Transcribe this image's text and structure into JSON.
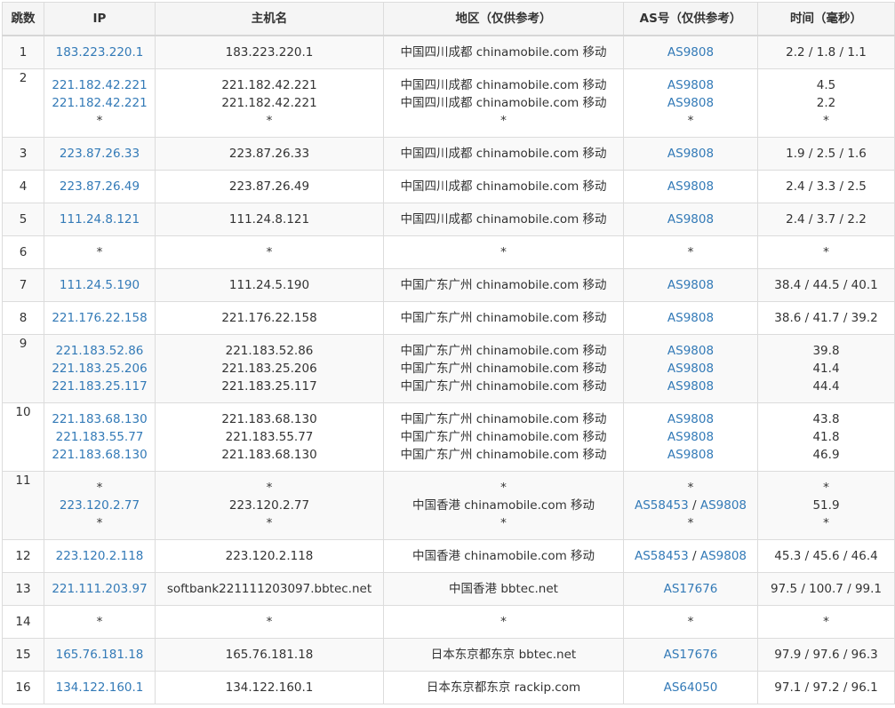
{
  "columns": [
    "跳数",
    "IP",
    "主机名",
    "地区（仅供参考）",
    "AS号（仅供参考）",
    "时间（毫秒）"
  ],
  "rows": [
    {
      "hop": "1",
      "ips": [
        "183.223.220.1"
      ],
      "hosts": [
        "183.223.220.1"
      ],
      "regions": [
        "中国四川成都 chinamobile.com 移动"
      ],
      "asns": [
        [
          "AS9808"
        ]
      ],
      "times": [
        "2.2 / 1.8 / 1.1"
      ]
    },
    {
      "hop": "2",
      "ips": [
        "221.182.42.221",
        "221.182.42.221",
        "*"
      ],
      "hosts": [
        "221.182.42.221",
        "221.182.42.221",
        "*"
      ],
      "regions": [
        "中国四川成都 chinamobile.com 移动",
        "中国四川成都 chinamobile.com 移动",
        "*"
      ],
      "asns": [
        [
          "AS9808"
        ],
        [
          "AS9808"
        ],
        [
          "*"
        ]
      ],
      "times": [
        "4.5",
        "2.2",
        "*"
      ]
    },
    {
      "hop": "3",
      "ips": [
        "223.87.26.33"
      ],
      "hosts": [
        "223.87.26.33"
      ],
      "regions": [
        "中国四川成都 chinamobile.com 移动"
      ],
      "asns": [
        [
          "AS9808"
        ]
      ],
      "times": [
        "1.9 / 2.5 / 1.6"
      ]
    },
    {
      "hop": "4",
      "ips": [
        "223.87.26.49"
      ],
      "hosts": [
        "223.87.26.49"
      ],
      "regions": [
        "中国四川成都 chinamobile.com 移动"
      ],
      "asns": [
        [
          "AS9808"
        ]
      ],
      "times": [
        "2.4 / 3.3 / 2.5"
      ]
    },
    {
      "hop": "5",
      "ips": [
        "111.24.8.121"
      ],
      "hosts": [
        "111.24.8.121"
      ],
      "regions": [
        "中国四川成都 chinamobile.com 移动"
      ],
      "asns": [
        [
          "AS9808"
        ]
      ],
      "times": [
        "2.4 / 3.7 / 2.2"
      ]
    },
    {
      "hop": "6",
      "ips": [
        "*"
      ],
      "hosts": [
        "*"
      ],
      "regions": [
        "*"
      ],
      "asns": [
        [
          "*"
        ]
      ],
      "times": [
        "*"
      ]
    },
    {
      "hop": "7",
      "ips": [
        "111.24.5.190"
      ],
      "hosts": [
        "111.24.5.190"
      ],
      "regions": [
        "中国广东广州 chinamobile.com 移动"
      ],
      "asns": [
        [
          "AS9808"
        ]
      ],
      "times": [
        "38.4 / 44.5 / 40.1"
      ]
    },
    {
      "hop": "8",
      "ips": [
        "221.176.22.158"
      ],
      "hosts": [
        "221.176.22.158"
      ],
      "regions": [
        "中国广东广州 chinamobile.com 移动"
      ],
      "asns": [
        [
          "AS9808"
        ]
      ],
      "times": [
        "38.6 / 41.7 / 39.2"
      ]
    },
    {
      "hop": "9",
      "ips": [
        "221.183.52.86",
        "221.183.25.206",
        "221.183.25.117"
      ],
      "hosts": [
        "221.183.52.86",
        "221.183.25.206",
        "221.183.25.117"
      ],
      "regions": [
        "中国广东广州 chinamobile.com 移动",
        "中国广东广州 chinamobile.com 移动",
        "中国广东广州 chinamobile.com 移动"
      ],
      "asns": [
        [
          "AS9808"
        ],
        [
          "AS9808"
        ],
        [
          "AS9808"
        ]
      ],
      "times": [
        "39.8",
        "41.4",
        "44.4"
      ]
    },
    {
      "hop": "10",
      "ips": [
        "221.183.68.130",
        "221.183.55.77",
        "221.183.68.130"
      ],
      "hosts": [
        "221.183.68.130",
        "221.183.55.77",
        "221.183.68.130"
      ],
      "regions": [
        "中国广东广州 chinamobile.com 移动",
        "中国广东广州 chinamobile.com 移动",
        "中国广东广州 chinamobile.com 移动"
      ],
      "asns": [
        [
          "AS9808"
        ],
        [
          "AS9808"
        ],
        [
          "AS9808"
        ]
      ],
      "times": [
        "43.8",
        "41.8",
        "46.9"
      ]
    },
    {
      "hop": "11",
      "ips": [
        "*",
        "223.120.2.77",
        "*"
      ],
      "hosts": [
        "*",
        "223.120.2.77",
        "*"
      ],
      "regions": [
        "*",
        "中国香港 chinamobile.com 移动",
        "*"
      ],
      "asns": [
        [
          "*"
        ],
        [
          "AS58453",
          "AS9808"
        ],
        [
          "*"
        ]
      ],
      "times": [
        "*",
        "51.9",
        "*"
      ]
    },
    {
      "hop": "12",
      "ips": [
        "223.120.2.118"
      ],
      "hosts": [
        "223.120.2.118"
      ],
      "regions": [
        "中国香港 chinamobile.com 移动"
      ],
      "asns": [
        [
          "AS58453",
          "AS9808"
        ]
      ],
      "times": [
        "45.3 / 45.6 / 46.4"
      ]
    },
    {
      "hop": "13",
      "ips": [
        "221.111.203.97"
      ],
      "hosts": [
        "softbank221111203097.bbtec.net"
      ],
      "regions": [
        "中国香港 bbtec.net"
      ],
      "asns": [
        [
          "AS17676"
        ]
      ],
      "times": [
        "97.5 / 100.7 / 99.1"
      ]
    },
    {
      "hop": "14",
      "ips": [
        "*"
      ],
      "hosts": [
        "*"
      ],
      "regions": [
        "*"
      ],
      "asns": [
        [
          "*"
        ]
      ],
      "times": [
        "*"
      ]
    },
    {
      "hop": "15",
      "ips": [
        "165.76.181.18"
      ],
      "hosts": [
        "165.76.181.18"
      ],
      "regions": [
        "日本东京都东京 bbtec.net"
      ],
      "asns": [
        [
          "AS17676"
        ]
      ],
      "times": [
        "97.9 / 97.6 / 96.3"
      ]
    },
    {
      "hop": "16",
      "ips": [
        "134.122.160.1"
      ],
      "hosts": [
        "134.122.160.1"
      ],
      "regions": [
        "日本东京都东京 rackip.com"
      ],
      "asns": [
        [
          "AS64050"
        ]
      ],
      "times": [
        "97.1 / 97.2 / 96.1"
      ]
    }
  ],
  "colors": {
    "link": "#337ab7",
    "text": "#333333",
    "header_bg": "#f5f5f5",
    "stripe": "#f9f9f9",
    "border": "#dcdcdc"
  }
}
